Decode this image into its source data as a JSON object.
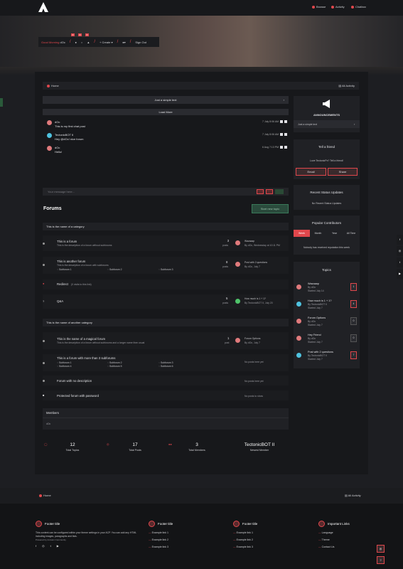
{
  "header": {
    "nav": [
      "Browse",
      "Activity",
      "Chatbox"
    ]
  },
  "userbar": {
    "greeting": "Good Morning",
    "user": "dOc",
    "create": "Create",
    "signout": "Sign Out",
    "notifications": [
      "0",
      "0",
      "0"
    ]
  },
  "breadcrumb": {
    "home": "Home",
    "activity": "All Activity"
  },
  "chat": {
    "announce": "Just a simple text",
    "load_more": "Load More",
    "messages": [
      {
        "user": "dOc",
        "text": "This is my first chat post",
        "time": "7 July 8:06 AM"
      },
      {
        "user": "TectonicBOT II",
        "text": "Hey @dOc! nice forum",
        "time": "7 July 8:06 AM"
      },
      {
        "user": "dOc",
        "text": "Hello!",
        "time": "6 Aug 7:13 PM"
      }
    ],
    "placeholder": "Your message here..."
  },
  "forums": {
    "title": "Forums",
    "start_label": "Start new topic",
    "cat1": "This is the name of a category",
    "f1": {
      "title": "This is a forum",
      "desc": "This is the description of a forum without subforums",
      "count": "3",
      "unit": "posts",
      "last": "Wazaaap",
      "by": "By dOc, Wednesday at 10:11 PM"
    },
    "f2": {
      "title": "This is another forum",
      "desc": "This is the description of a forum with subforums",
      "subs": [
        "Subforum 1",
        "Subforum 2",
        "Subforum 3"
      ],
      "count": "8",
      "unit": "posts",
      "last": "Post with 2 questions",
      "by": "By dOc, July 7"
    },
    "f3": {
      "title": "Redirect",
      "desc": "(0 visits to this link)"
    },
    "f4": {
      "title": "Q&A",
      "count": "5",
      "unit": "posts",
      "last": "How much is 1 + 1?",
      "by": "By TectonicBOT II, July 20"
    },
    "cat2": "This is the name of another category",
    "f5": {
      "title": "This is the name of a magical forum",
      "desc": "This is the description of a forum without subforums and a longer name then usual",
      "count": "1",
      "unit": "post",
      "last": "Forum Options",
      "by": "By dOc, July 7"
    },
    "f6": {
      "title": "This is a forum with more than 3 subforums",
      "subs": [
        "Subforum 1",
        "Subforum 2",
        "Subforum 3",
        "Subforum 4",
        "Subforum 5",
        "Subforum 6"
      ],
      "empty": "No posts here yet"
    },
    "f7": {
      "title": "Forum with no description",
      "empty": "No posts here yet"
    },
    "f8": {
      "title": "Protected forum with password",
      "empty": "No posts to show"
    }
  },
  "members": {
    "title": "Members",
    "list": "dOc"
  },
  "stats": [
    {
      "n": "12",
      "l": "Total Topics"
    },
    {
      "n": "17",
      "l": "Total Posts"
    },
    {
      "n": "3",
      "l": "Total Members"
    },
    {
      "n": "TectonicBOT II",
      "l": "Newest Member"
    }
  ],
  "sidebar": {
    "ann_title": "ANNOUNCEMENTS",
    "ann_text": "Just a simple text",
    "tell_title": "Tell a friend",
    "tell_sub": "Love TectonicPx? Tell a friend!",
    "email": "Email",
    "share": "Share",
    "status_title": "Recent Status Updates",
    "status_empty": "No Recent Status Updates",
    "contrib_title": "Popular Contributors",
    "tabs": [
      "Week",
      "Month",
      "Year",
      "All Time"
    ],
    "contrib_empty": "Nobody has received reputation this week",
    "topics_title": "Topics",
    "topics": [
      {
        "t": "Wazaaap",
        "by": "By dOc",
        "s": "Started July 14",
        "n": "1"
      },
      {
        "t": "How much is 1 + 1?",
        "by": "By TectonicBOT II",
        "s": "Started July 7",
        "n": "4"
      },
      {
        "t": "Forum Options",
        "by": "By dOc",
        "s": "Started July 7",
        "n": "0"
      },
      {
        "t": "Hey Friend",
        "by": "By dOc",
        "s": "Started July 7",
        "n": "0"
      },
      {
        "t": "Post with 2 questions",
        "by": "By TectonicBOT II",
        "s": "Started July 7",
        "n": "7"
      }
    ]
  },
  "footer": {
    "home": "Home",
    "activity": "All Activity",
    "col1": {
      "t": "Footer title",
      "text": "This content can be configured within your theme settings in your ACP. You can add any HTML including images, paragraphs and lists.",
      "powered": "Powered by Invision Community"
    },
    "col2": {
      "t": "Footer title",
      "links": [
        "Example link 1",
        "Example link 2",
        "Example link 3"
      ]
    },
    "col3": {
      "t": "Footer title",
      "links": [
        "Example link 1",
        "Example link 2",
        "Example link 3"
      ]
    },
    "col4": {
      "t": "Important Links",
      "links": [
        "Language",
        "Theme",
        "Contact Us"
      ]
    }
  },
  "colors": {
    "accent": "#e0474c",
    "bg": "#1d1e22",
    "panel": "#202125"
  }
}
